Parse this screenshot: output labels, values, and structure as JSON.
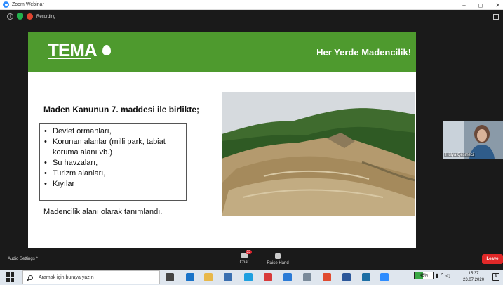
{
  "window": {
    "title": "Zoom Webinar"
  },
  "meeting_status": {
    "recording_label": "Recording"
  },
  "slide": {
    "logo_text": "TEMA",
    "title": "Her Yerde Madencilik!",
    "heading": "Maden Kanunun 7. maddesi ile birlikte;",
    "list_items": [
      "Devlet ormanları,",
      "Korunan alanlar (milli park, tabiat koruma alanı vb.)",
      "Su havzaları,",
      "Turizm alanları,",
      "Kıyılar"
    ],
    "footer": "Madencilik alanı olarak tanımlandı.",
    "colors": {
      "header": "#4e9a2e"
    }
  },
  "participant": {
    "name": "Hülya Çeşmeci"
  },
  "controls": {
    "audio_settings": "Audio Settings",
    "audio_chevron": "^",
    "chat_label": "Chat",
    "chat_badge": "33",
    "raise_hand": "Raise Hand",
    "leave": "Leave"
  },
  "taskbar": {
    "search_placeholder": "Aramak için buraya yazın",
    "battery": "46%",
    "time": "15:37",
    "date": "23.07.2020",
    "notification_count": "6"
  }
}
